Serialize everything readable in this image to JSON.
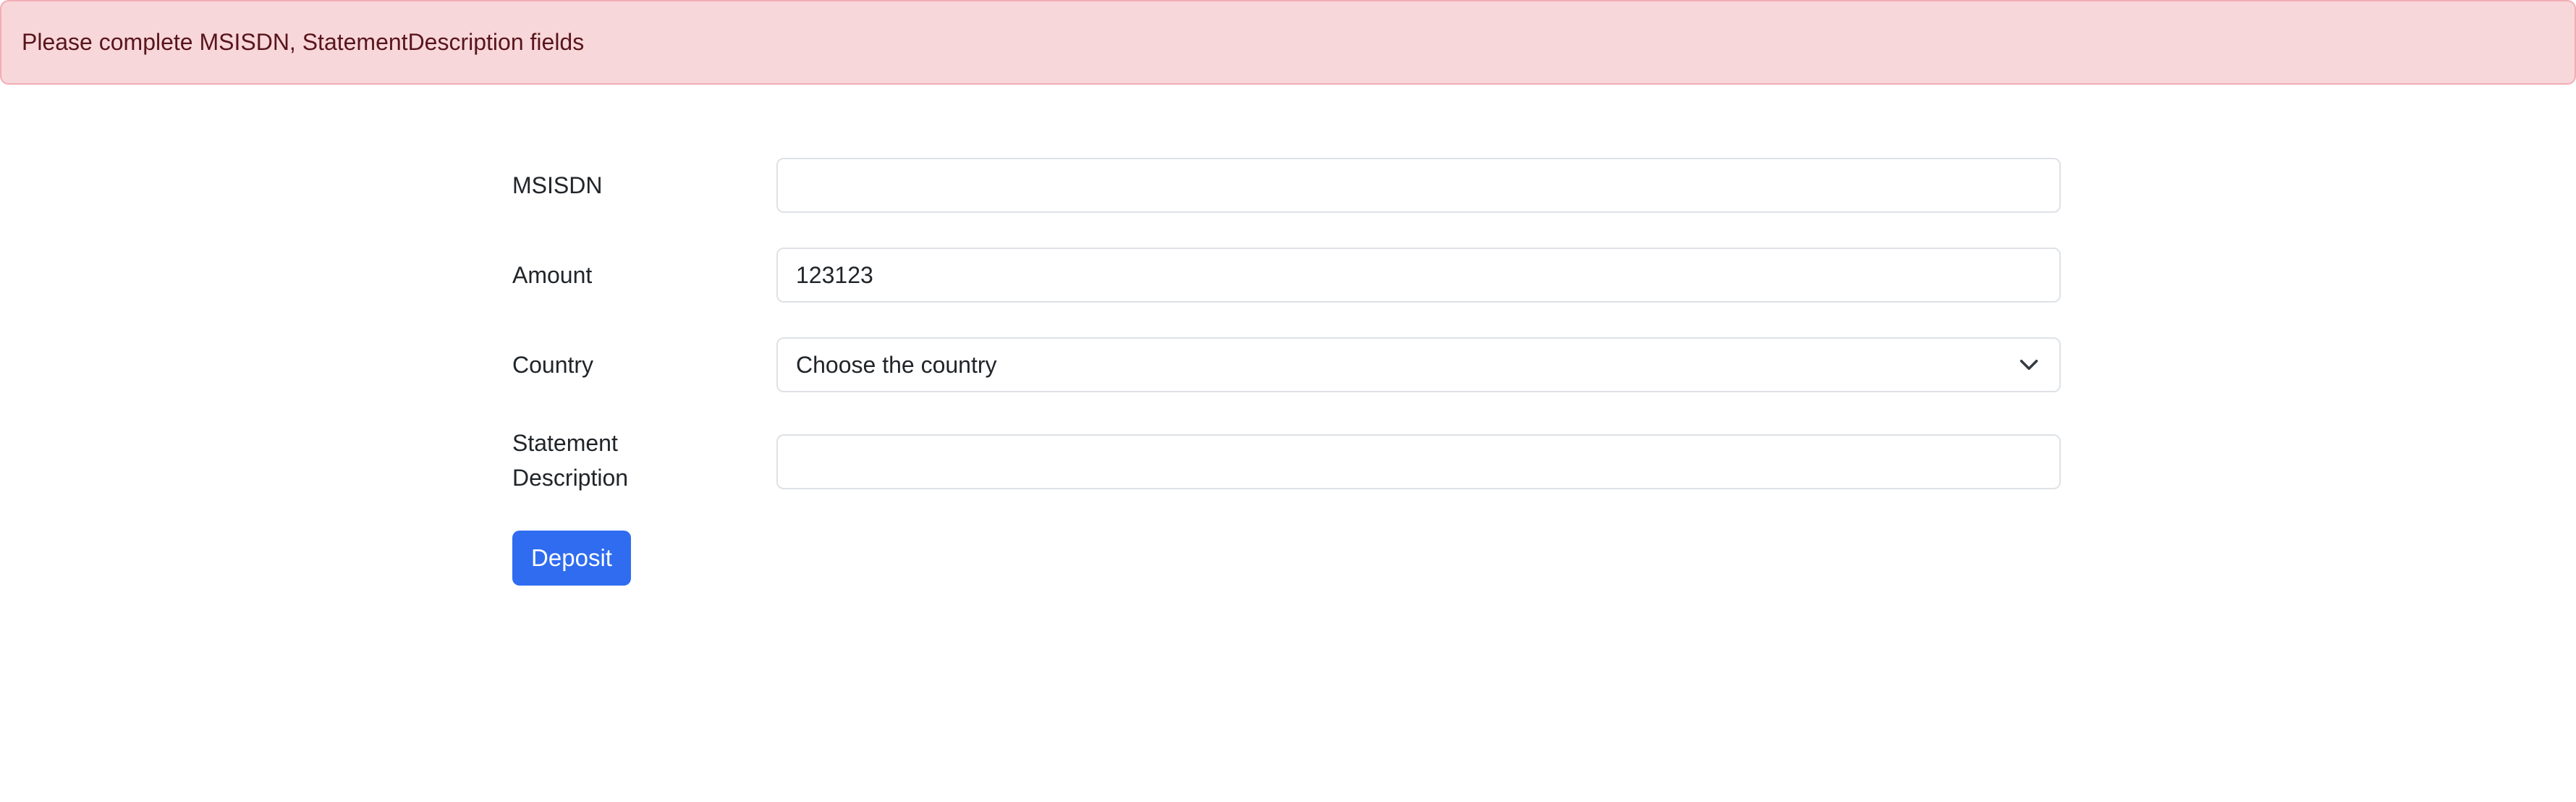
{
  "alert": {
    "message": "Please complete MSISDN, StatementDescription fields",
    "color": "#f8d7da"
  },
  "form": {
    "msisdn": {
      "label": "MSISDN",
      "value": ""
    },
    "amount": {
      "label": "Amount",
      "value": "123123"
    },
    "country": {
      "label": "Country",
      "selected": "Choose the country",
      "icon": "chevron-down-icon"
    },
    "statement_description": {
      "label_line1": "Statement",
      "label_line2": "Description",
      "value": ""
    },
    "deposit_button": {
      "label": "Deposit",
      "color": "#2f6cf0"
    }
  }
}
